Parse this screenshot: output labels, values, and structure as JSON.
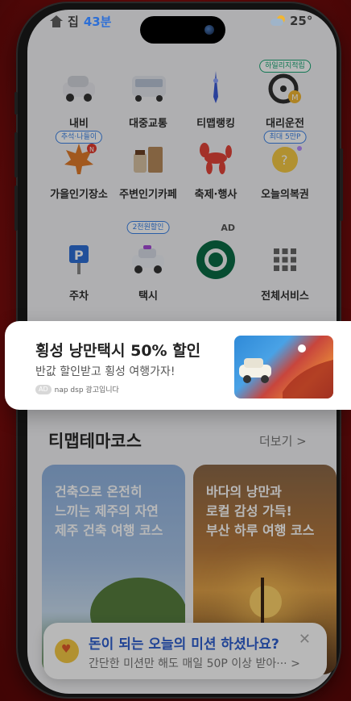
{
  "status_bar": {
    "home_label": "집",
    "eta": "43분",
    "temperature": "25°"
  },
  "services": [
    {
      "label": "내비",
      "badge": "",
      "icon": "car-icon"
    },
    {
      "label": "대중교통",
      "badge": "",
      "icon": "bus-icon"
    },
    {
      "label": "티맵랭킹",
      "badge": "",
      "icon": "pin-icon"
    },
    {
      "label": "대리운전",
      "badge": "하일리지적립",
      "icon": "steering-icon"
    },
    {
      "label": "가을인기장소",
      "badge": "추석·나들이",
      "icon": "maple-leaf-icon"
    },
    {
      "label": "주변인기카페",
      "badge": "",
      "icon": "coffee-icon"
    },
    {
      "label": "축제·행사",
      "badge": "",
      "icon": "balloon-dog-icon"
    },
    {
      "label": "오늘의복권",
      "badge": "최대 5만P",
      "icon": "lottery-icon"
    },
    {
      "label": "주차",
      "badge": "",
      "icon": "parking-icon"
    },
    {
      "label": "택시",
      "badge": "2천원할인",
      "icon": "taxi-icon"
    },
    {
      "label": "",
      "badge": "",
      "icon": "starbucks-logo-icon",
      "ad": "AD"
    },
    {
      "label": "전체서비스",
      "badge": "",
      "icon": "grid-icon"
    }
  ],
  "popup": {
    "title": "횡성 낭만택시 50% 할인",
    "subtitle": "반값 할인받고 횡성 여행가자!",
    "ad_pill": "AD",
    "meta": "nap dsp 광고입니다"
  },
  "theme_section": {
    "title": "티맵테마코스",
    "more": "더보기 >",
    "cards": [
      {
        "lines": [
          "건축으로 온전히",
          "느끼는 제주의 자연",
          "제주 건축 여행 코스"
        ]
      },
      {
        "lines": [
          "바다의 낭만과",
          "로컬 감성 가득!",
          "부산 하루 여행 코스"
        ]
      }
    ]
  },
  "mission": {
    "title": "돈이 되는 오늘의 미션 하셨나요?",
    "subtitle": "간단한 미션만 해도 매일 50P 이상 받아··· >",
    "close": "✕"
  }
}
